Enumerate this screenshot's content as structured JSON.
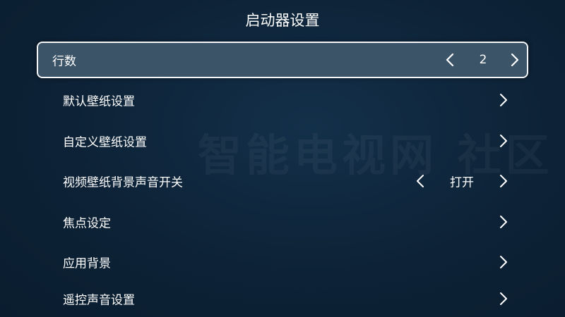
{
  "header": {
    "title": "启动器设置"
  },
  "watermark": "智能电视网 社区",
  "settings": {
    "rows": [
      {
        "label": "行数",
        "value": "2",
        "focused": true
      },
      {
        "label": "默认壁纸设置"
      },
      {
        "label": "自定义壁纸设置"
      },
      {
        "label": "视频壁纸背景声音开关",
        "value": "打开"
      },
      {
        "label": "焦点设定"
      },
      {
        "label": "应用背景"
      },
      {
        "label": "遥控声音设置"
      }
    ]
  },
  "icons": {
    "prev": "chevron-left-icon",
    "next": "chevron-right-icon"
  },
  "colors": {
    "background": "#0d2236",
    "focus_fill": "#3b5468",
    "focus_border": "#f4f6f8",
    "text": "#ffffff"
  }
}
